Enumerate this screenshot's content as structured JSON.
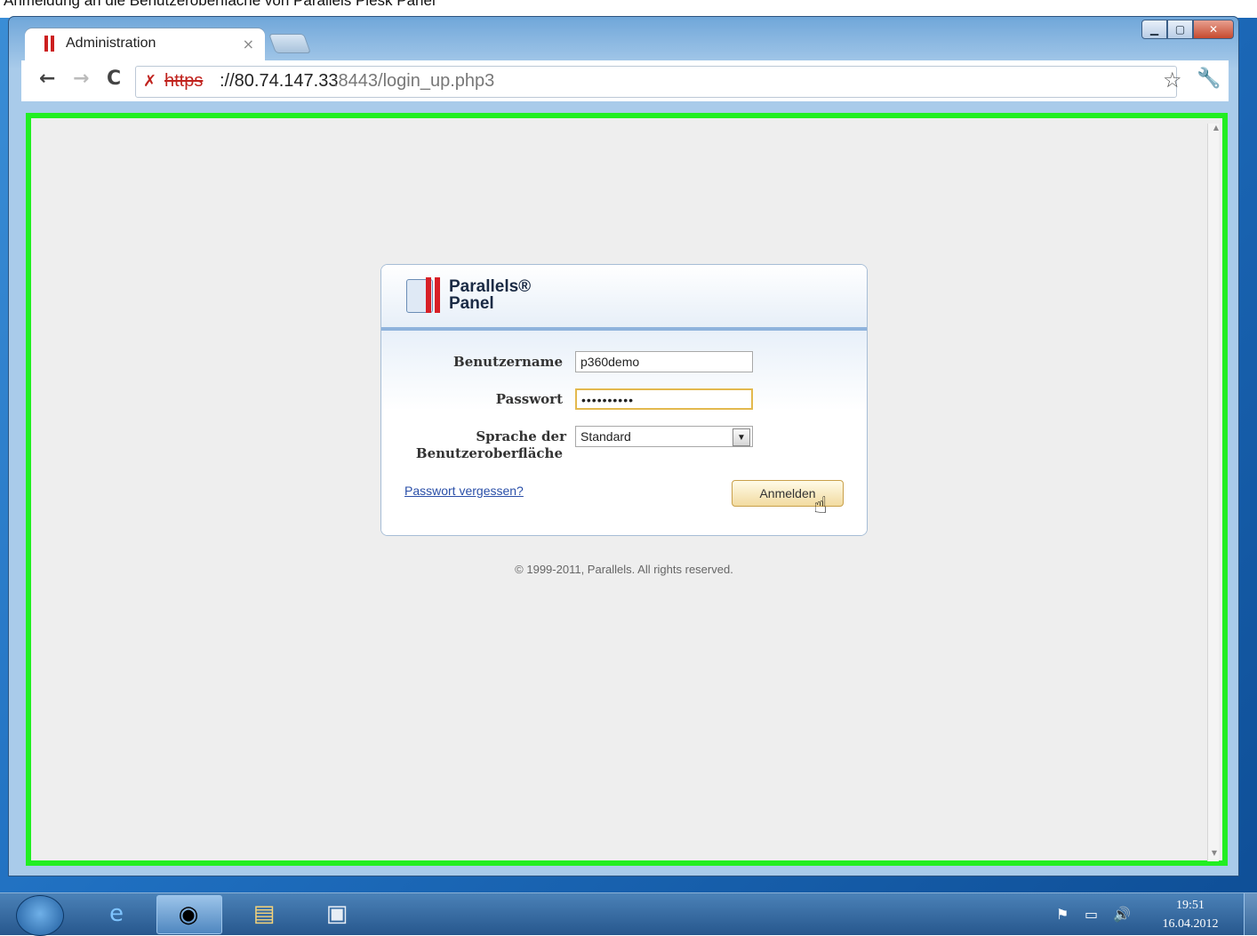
{
  "caption": "Anmeldung an die Benutzeroberfläche von Parallels Plesk Panel",
  "browser": {
    "tab_title": "Administration",
    "tab_close": "×",
    "url_scheme": "https",
    "url_host": "://80.74.147.33",
    "url_path": ":8443/login_up.php3"
  },
  "login": {
    "logo_line1": "Parallels®",
    "logo_line2": "Panel",
    "username_label": "Benutzername",
    "username_value": "p360demo",
    "password_label": "Passwort",
    "password_value": "••••••••••",
    "language_label_1": "Sprache der",
    "language_label_2": "Benutzeroberfläche",
    "language_value": "Standard",
    "forgot_link": "Passwort vergessen?",
    "submit_label": "Anmelden"
  },
  "footer": {
    "copyright": "© 1999-2011, Parallels. All rights reserved."
  },
  "taskbar": {
    "time": "19:51",
    "date": "16.04.2012"
  },
  "icons": {
    "back": "back-arrow-icon",
    "forward": "forward-arrow-icon",
    "reload": "reload-icon",
    "star": "bookmark-star-icon",
    "wrench": "wrench-icon"
  }
}
